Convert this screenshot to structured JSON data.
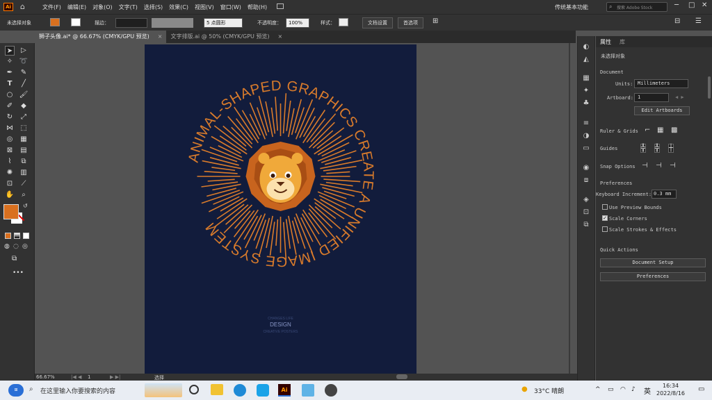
{
  "app": {
    "logo": "Ai"
  },
  "menubar": {
    "items": [
      "文件(F)",
      "编辑(E)",
      "对象(O)",
      "文字(T)",
      "选择(S)",
      "效果(C)",
      "视图(V)",
      "窗口(W)",
      "帮助(H)"
    ],
    "workspace": "传统基本功能",
    "search_placeholder": "搜索 Adobe Stock"
  },
  "control": {
    "selection_status": "未选择对象",
    "stroke_label": "描边：",
    "brush_label": "5 点圆形",
    "opacity_label": "不透明度：",
    "opacity_value": "100%",
    "style_label": "样式：",
    "doc_setup_button": "文档设置",
    "preferences_button": "首选项"
  },
  "tabs": [
    {
      "title": "狮子头像.ai* @ 66.67% (CMYK/GPU 预览)",
      "close": "×"
    },
    {
      "title": "文字排版.ai @ 50% (CMYK/GPU 预览)",
      "close": "×"
    }
  ],
  "artwork": {
    "ring_text": "ANIMAL-SHAPED GRAPHICS CREATE A UNIFIED IMAGE SYSTEM",
    "footer_line1": "CHANGES LIFE",
    "footer_line2": "DESIGN",
    "footer_line3": "CREATIVE POSTERS",
    "colors": {
      "background": "#121c3c",
      "accent": "#d97b2b",
      "mane": "#c8641e",
      "face": "#f0a93a"
    }
  },
  "panel": {
    "tab_properties": "属性",
    "tab_layers": "库",
    "no_selection": "未选择对象",
    "document_header": "Document",
    "units_label": "Units:",
    "units_value": "Millimeters",
    "artboard_label": "Artboard:",
    "artboard_value": "1",
    "edit_artboards_button": "Edit Artboards",
    "rulers_label": "Ruler & Grids",
    "guides_label": "Guides",
    "snap_label": "Snap Options",
    "preferences_header": "Preferences",
    "keyboard_increment_label": "Keyboard Increment:",
    "keyboard_increment_value": "0.3 mm",
    "use_preview_bounds": "Use Preview Bounds",
    "scale_corners": "Scale Corners",
    "scale_strokes": "Scale Strokes & Effects",
    "quick_actions_header": "Quick Actions",
    "document_setup_button": "Document Setup",
    "preferences_button": "Preferences"
  },
  "status": {
    "zoom": "66.67%",
    "artboard": "1",
    "tool": "选择"
  },
  "taskbar": {
    "search_placeholder": "在这里输入你要搜索的内容",
    "weather": "33°C 晴朗",
    "ime": "英",
    "time": "16:34",
    "date": "2022/8/16"
  }
}
